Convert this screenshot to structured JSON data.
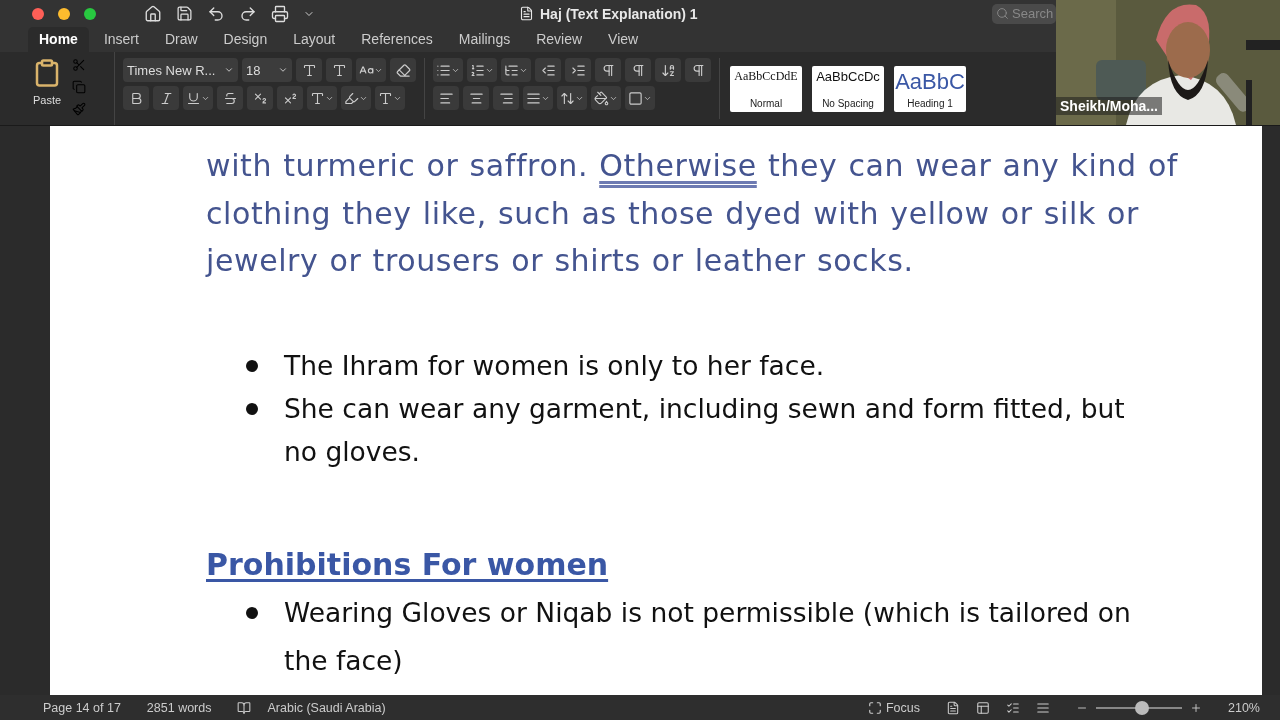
{
  "window": {
    "title": "Haj (Text Explanation) 1",
    "search_placeholder": "Search"
  },
  "ribbon_tabs": [
    {
      "label": "Home",
      "selected": true
    },
    {
      "label": "Insert",
      "selected": false
    },
    {
      "label": "Draw",
      "selected": false
    },
    {
      "label": "Design",
      "selected": false
    },
    {
      "label": "Layout",
      "selected": false
    },
    {
      "label": "References",
      "selected": false
    },
    {
      "label": "Mailings",
      "selected": false
    },
    {
      "label": "Review",
      "selected": false
    },
    {
      "label": "View",
      "selected": false
    }
  ],
  "clipboard": {
    "paste_label": "Paste"
  },
  "font": {
    "name": "Times New R...",
    "size": "18"
  },
  "styles": [
    {
      "kind": "normal",
      "preview": "AaBbCcDdE",
      "label": "Normal"
    },
    {
      "kind": "nospacing",
      "preview": "AaBbCcDc",
      "label": "No Spacing"
    },
    {
      "kind": "heading",
      "preview": "AaBbC",
      "label": "Heading 1"
    }
  ],
  "video": {
    "name": "Sheikh/Moha..."
  },
  "document": {
    "paragraph": [
      {
        "text": "with turmeric or saffron. ",
        "flagged": false
      },
      {
        "text": "Otherwise",
        "flagged": true
      },
      {
        "text": " they can wear any kind of clothing they like, such as those dyed with yellow or silk or jewelry or trousers or shirts or leather socks.",
        "flagged": false
      }
    ],
    "bullets": [
      "The Ihram for women is only to her face.",
      "She can wear any garment, including sewn and form fitted, but no gloves."
    ],
    "heading": "Prohibitions For women",
    "bullets_2": [
      "Wearing Gloves or Niqab is not permissible (which is tailored on the face)"
    ]
  },
  "status_bar": {
    "page": "Page 14 of 17",
    "words": "2851 words",
    "language": "Arabic (Saudi Arabia)",
    "focus": "Focus",
    "zoom": "210%",
    "zoom_slider": {
      "level": 0.54
    }
  }
}
